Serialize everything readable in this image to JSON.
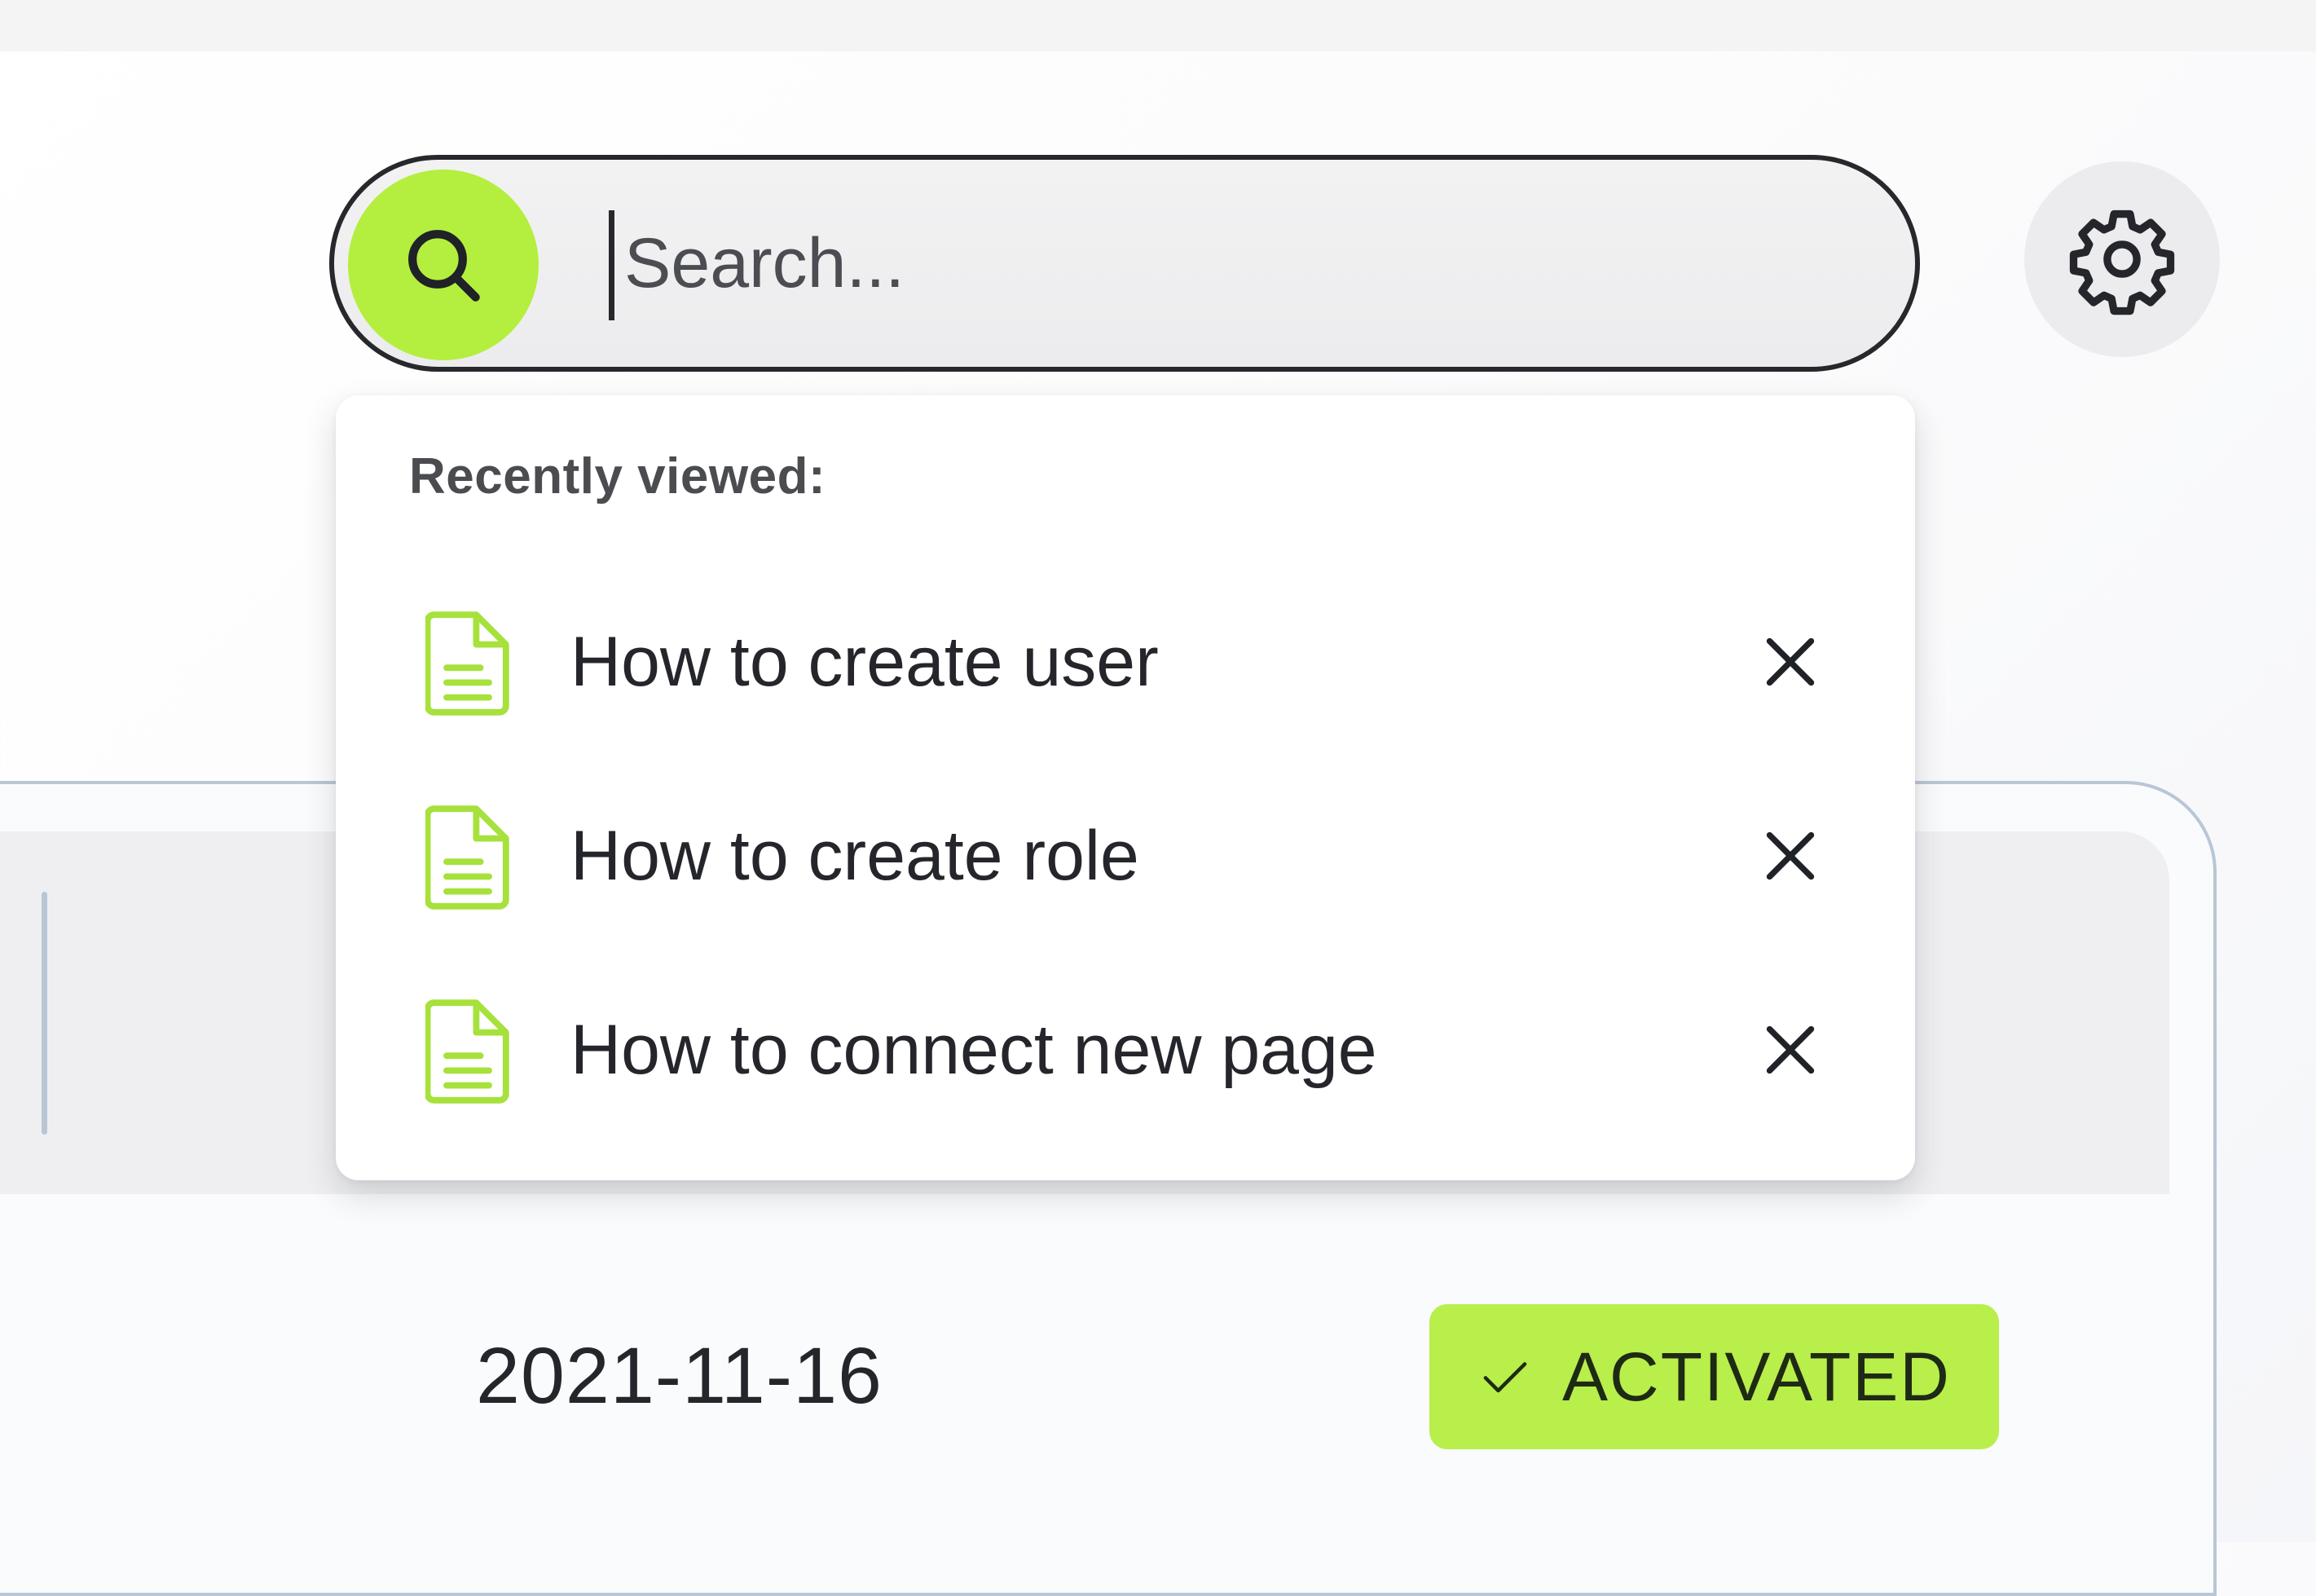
{
  "search": {
    "placeholder": "Search...",
    "value": ""
  },
  "recent": {
    "heading": "Recently viewed:",
    "items": [
      {
        "label": "How to create user"
      },
      {
        "label": "How to create role"
      },
      {
        "label": "How to connect new page"
      }
    ]
  },
  "table_row": {
    "date": "2021-11-16",
    "status": "ACTIVATED"
  },
  "icons": {
    "search": "search-icon",
    "settings": "gear-icon",
    "document": "document-icon",
    "remove": "close-icon",
    "status": "check-icon"
  },
  "colors": {
    "accent": "#b4ef3f",
    "badge": "#b8ef4b",
    "border": "#27282c",
    "card_border": "#b9c6d6"
  }
}
